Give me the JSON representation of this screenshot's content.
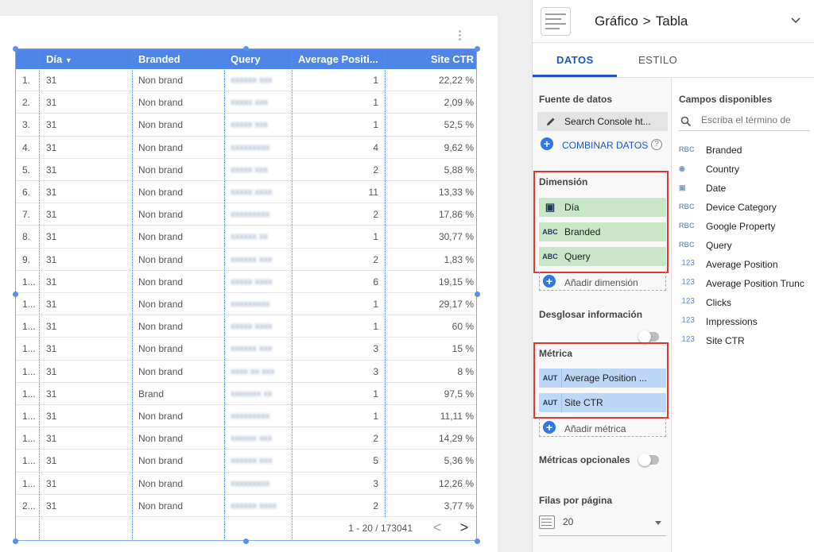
{
  "table": {
    "headers": [
      "Día",
      "Branded",
      "Query",
      "Average Positi...",
      "Site CTR"
    ],
    "sort_indicator": "▼",
    "rows": [
      {
        "n": "1.",
        "dia": "31",
        "branded": "Non brand",
        "query": "xxxxxx xxx",
        "pos": "1",
        "ctr": "22,22 %"
      },
      {
        "n": "2.",
        "dia": "31",
        "branded": "Non brand",
        "query": "xxxxx xxx",
        "pos": "1",
        "ctr": "2,09 %"
      },
      {
        "n": "3.",
        "dia": "31",
        "branded": "Non brand",
        "query": "xxxxx xxx",
        "pos": "1",
        "ctr": "52,5 %"
      },
      {
        "n": "4.",
        "dia": "31",
        "branded": "Non brand",
        "query": "xxxxxxxxx",
        "pos": "4",
        "ctr": "9,62 %"
      },
      {
        "n": "5.",
        "dia": "31",
        "branded": "Non brand",
        "query": "xxxxx xxx",
        "pos": "2",
        "ctr": "5,88 %"
      },
      {
        "n": "6.",
        "dia": "31",
        "branded": "Non brand",
        "query": "xxxxx xxxx",
        "pos": "11",
        "ctr": "13,33 %"
      },
      {
        "n": "7.",
        "dia": "31",
        "branded": "Non brand",
        "query": "xxxxxxxxx",
        "pos": "2",
        "ctr": "17,86 %"
      },
      {
        "n": "8.",
        "dia": "31",
        "branded": "Non brand",
        "query": "xxxxxx xx",
        "pos": "1",
        "ctr": "30,77 %"
      },
      {
        "n": "9.",
        "dia": "31",
        "branded": "Non brand",
        "query": "xxxxxx xxx",
        "pos": "2",
        "ctr": "1,83 %"
      },
      {
        "n": "1...",
        "dia": "31",
        "branded": "Non brand",
        "query": "xxxxx xxxx",
        "pos": "6",
        "ctr": "19,15 %"
      },
      {
        "n": "1...",
        "dia": "31",
        "branded": "Non brand",
        "query": "xxxxxxxxx",
        "pos": "1",
        "ctr": "29,17 %"
      },
      {
        "n": "1...",
        "dia": "31",
        "branded": "Non brand",
        "query": "xxxxx xxxx",
        "pos": "1",
        "ctr": "60 %"
      },
      {
        "n": "1...",
        "dia": "31",
        "branded": "Non brand",
        "query": "xxxxxx xxx",
        "pos": "3",
        "ctr": "15 %"
      },
      {
        "n": "1...",
        "dia": "31",
        "branded": "Non brand",
        "query": "xxxx xx xxx",
        "pos": "3",
        "ctr": "8 %"
      },
      {
        "n": "1...",
        "dia": "31",
        "branded": "Brand",
        "query": "xxxxxxx xx",
        "pos": "1",
        "ctr": "97,5 %"
      },
      {
        "n": "1...",
        "dia": "31",
        "branded": "Non brand",
        "query": "xxxxxxxxx",
        "pos": "1",
        "ctr": "11,11 %"
      },
      {
        "n": "1...",
        "dia": "31",
        "branded": "Non brand",
        "query": "xxxxxx xxx",
        "pos": "2",
        "ctr": "14,29 %"
      },
      {
        "n": "1...",
        "dia": "31",
        "branded": "Non brand",
        "query": "xxxxxx xxx",
        "pos": "5",
        "ctr": "5,36 %"
      },
      {
        "n": "1...",
        "dia": "31",
        "branded": "Non brand",
        "query": "xxxxxxxxx",
        "pos": "3",
        "ctr": "12,26 %"
      },
      {
        "n": "2...",
        "dia": "31",
        "branded": "Non brand",
        "query": "xxxxxx xxxx",
        "pos": "2",
        "ctr": "3,77 %"
      }
    ],
    "pager": {
      "range": "1 - 20 / 173041",
      "prev": "<",
      "next": ">"
    }
  },
  "panel": {
    "breadcrumb": {
      "part1": "Gráfico",
      "sep": ">",
      "part2": "Tabla"
    },
    "tabs": {
      "data": "DATOS",
      "style": "ESTILO"
    },
    "data_source": {
      "title": "Fuente de datos",
      "name": "Search Console ht...",
      "blend_label": "COMBINAR DATOS",
      "help": "?"
    },
    "dimension": {
      "title": "Dimensión",
      "items": [
        {
          "tag": "▣",
          "label": "Día"
        },
        {
          "tag": "ABC",
          "label": "Branded"
        },
        {
          "tag": "ABC",
          "label": "Query"
        }
      ],
      "add_label": "Añadir dimensión"
    },
    "drilldown": {
      "title": "Desglosar información"
    },
    "metric": {
      "title": "Métrica",
      "items": [
        {
          "tag": "AUT",
          "label": "Average Position ..."
        },
        {
          "tag": "AUT",
          "label": "Site CTR"
        }
      ],
      "add_label": "Añadir métrica"
    },
    "optional_metrics": {
      "title": "Métricas opcionales"
    },
    "rows_per_page": {
      "title": "Filas por página",
      "value": "20"
    },
    "available": {
      "title": "Campos disponibles",
      "search_placeholder": "Escriba el término de",
      "fields": [
        {
          "icon": "RBC",
          "label": "Branded"
        },
        {
          "icon": "◉",
          "label": "Country"
        },
        {
          "icon": "▣",
          "label": "Date"
        },
        {
          "icon": "RBC",
          "label": "Device Category"
        },
        {
          "icon": "RBC",
          "label": "Google Property"
        },
        {
          "icon": "RBC",
          "label": "Query"
        },
        {
          "icon": "123",
          "label": "Average Position"
        },
        {
          "icon": "123",
          "label": "Average Position Trunc"
        },
        {
          "icon": "123",
          "label": "Clicks"
        },
        {
          "icon": "123",
          "label": "Impressions"
        },
        {
          "icon": "123",
          "label": "Site CTR"
        }
      ]
    }
  },
  "colors": {
    "accent": "#1a56c9",
    "header_blue": "#4e86e8",
    "highlight_red": "#e3372e",
    "dimension_green": "#c9e6c7",
    "metric_blue": "#bcd8f6"
  }
}
